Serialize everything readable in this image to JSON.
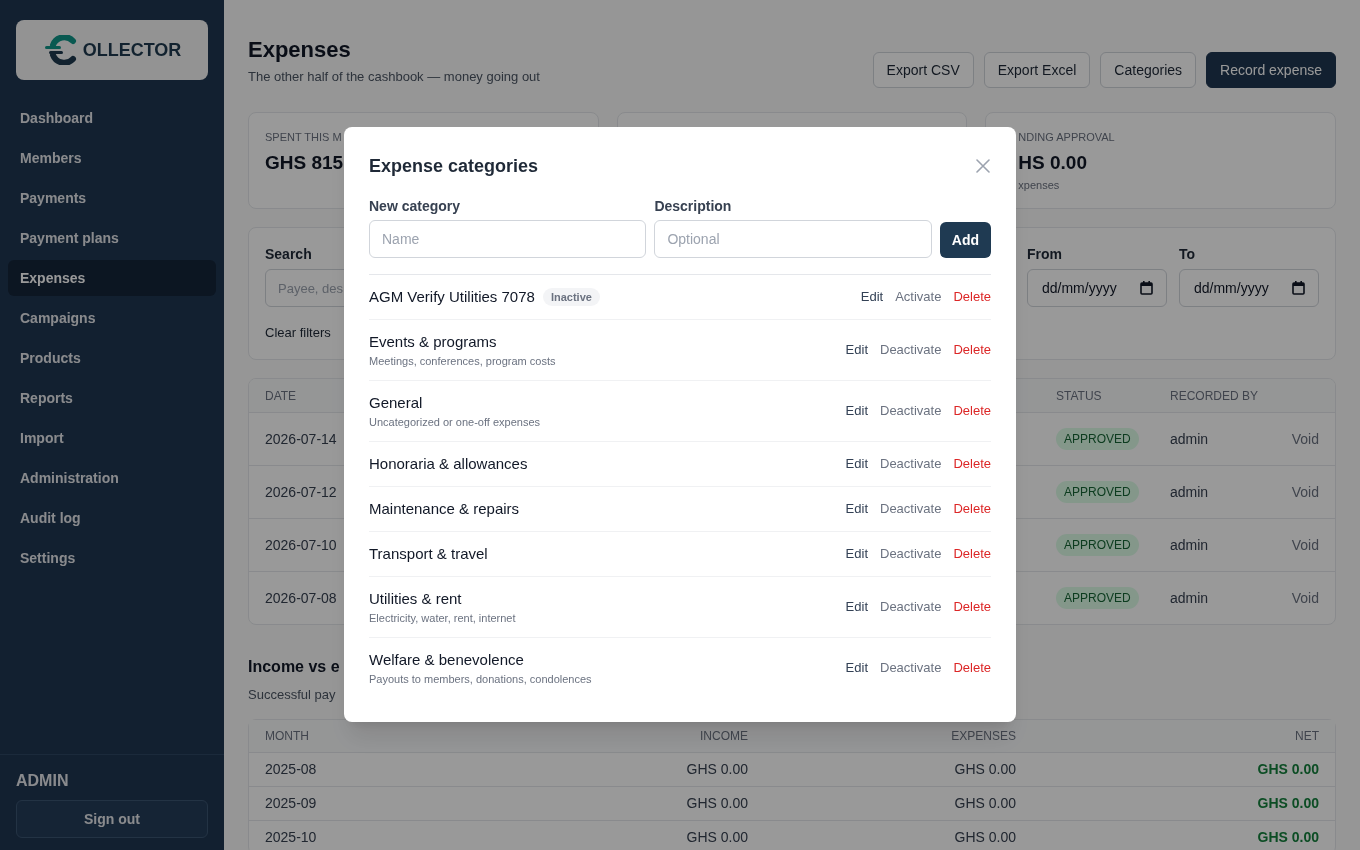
{
  "sidebar": {
    "logo": {
      "text": "OLLECTOR"
    },
    "items": [
      {
        "label": "Dashboard",
        "selected": false
      },
      {
        "label": "Members",
        "selected": false
      },
      {
        "label": "Payments",
        "selected": false
      },
      {
        "label": "Payment plans",
        "selected": false
      },
      {
        "label": "Expenses",
        "selected": true
      },
      {
        "label": "Campaigns",
        "selected": false
      },
      {
        "label": "Products",
        "selected": false
      },
      {
        "label": "Reports",
        "selected": false
      },
      {
        "label": "Import",
        "selected": false
      },
      {
        "label": "Administration",
        "selected": false
      },
      {
        "label": "Audit log",
        "selected": false
      },
      {
        "label": "Settings",
        "selected": false
      }
    ],
    "user": "ADMIN",
    "sign_out": "Sign out"
  },
  "header": {
    "title": "Expenses",
    "subtitle": "The other half of the cashbook — money going out",
    "buttons": [
      {
        "label": "Export CSV",
        "kind": "outline"
      },
      {
        "label": "Export Excel",
        "kind": "outline"
      },
      {
        "label": "Categories",
        "kind": "outline"
      },
      {
        "label": "Record expense",
        "kind": "primary"
      }
    ]
  },
  "stat_cards": [
    {
      "label": "SPENT THIS M",
      "value": "GHS 815"
    },
    {
      "label": "NDING APPROVAL",
      "value": "HS 0.00",
      "note": "xpenses"
    }
  ],
  "filters": {
    "search": {
      "label": "Search",
      "placeholder": "Payee, des"
    },
    "dates": [
      {
        "label": "From",
        "value": "dd/mm/yyyy"
      },
      {
        "label": "To",
        "value": "dd/mm/yyyy"
      }
    ],
    "clear": "Clear filters"
  },
  "expenses_table": {
    "columns": {
      "date": "DATE",
      "status": "STATUS",
      "recorded_by": "RECORDED BY"
    },
    "rows": [
      {
        "date": "2026-07-14",
        "status": "APPROVED",
        "recorded_by": "admin",
        "action": "Void"
      },
      {
        "date": "2026-07-12",
        "status": "APPROVED",
        "recorded_by": "admin",
        "action": "Void"
      },
      {
        "date": "2026-07-10",
        "status": "APPROVED",
        "recorded_by": "admin",
        "action": "Void"
      },
      {
        "date": "2026-07-08",
        "status": "APPROVED",
        "recorded_by": "admin",
        "action": "Void"
      }
    ]
  },
  "income_section": {
    "title": "Income vs e",
    "subtitle": "Successful pay",
    "columns": [
      "MONTH",
      "INCOME",
      "EXPENSES",
      "NET"
    ],
    "rows": [
      {
        "month": "2025-08",
        "income": "GHS 0.00",
        "expenses": "GHS 0.00",
        "net": "GHS 0.00"
      },
      {
        "month": "2025-09",
        "income": "GHS 0.00",
        "expenses": "GHS 0.00",
        "net": "GHS 0.00"
      },
      {
        "month": "2025-10",
        "income": "GHS 0.00",
        "expenses": "GHS 0.00",
        "net": "GHS 0.00"
      }
    ]
  },
  "modal": {
    "title": "Expense categories",
    "fields": [
      {
        "label": "New category",
        "placeholder": "Name"
      },
      {
        "label": "Description",
        "placeholder": "Optional"
      }
    ],
    "add_button": "Add",
    "categories": [
      {
        "name": "AGM Verify Utilities 7078",
        "badge": "Inactive",
        "actions": [
          {
            "label": "Edit",
            "kind": "edit"
          },
          {
            "label": "Activate",
            "kind": "toggle"
          },
          {
            "label": "Delete",
            "kind": "delete"
          }
        ]
      },
      {
        "name": "Events & programs",
        "description": "Meetings, conferences, program costs",
        "actions": [
          {
            "label": "Edit",
            "kind": "edit"
          },
          {
            "label": "Deactivate",
            "kind": "toggle"
          },
          {
            "label": "Delete",
            "kind": "delete"
          }
        ]
      },
      {
        "name": "General",
        "description": "Uncategorized or one-off expenses",
        "actions": [
          {
            "label": "Edit",
            "kind": "edit"
          },
          {
            "label": "Deactivate",
            "kind": "toggle"
          },
          {
            "label": "Delete",
            "kind": "delete"
          }
        ]
      },
      {
        "name": "Honoraria & allowances",
        "actions": [
          {
            "label": "Edit",
            "kind": "edit"
          },
          {
            "label": "Deactivate",
            "kind": "toggle"
          },
          {
            "label": "Delete",
            "kind": "delete"
          }
        ]
      },
      {
        "name": "Maintenance & repairs",
        "actions": [
          {
            "label": "Edit",
            "kind": "edit"
          },
          {
            "label": "Deactivate",
            "kind": "toggle"
          },
          {
            "label": "Delete",
            "kind": "delete"
          }
        ]
      },
      {
        "name": "Transport & travel",
        "actions": [
          {
            "label": "Edit",
            "kind": "edit"
          },
          {
            "label": "Deactivate",
            "kind": "toggle"
          },
          {
            "label": "Delete",
            "kind": "delete"
          }
        ]
      },
      {
        "name": "Utilities & rent",
        "description": "Electricity, water, rent, internet",
        "actions": [
          {
            "label": "Edit",
            "kind": "edit"
          },
          {
            "label": "Deactivate",
            "kind": "toggle"
          },
          {
            "label": "Delete",
            "kind": "delete"
          }
        ]
      },
      {
        "name": "Welfare & benevolence",
        "description": "Payouts to members, donations, condolences",
        "actions": [
          {
            "label": "Edit",
            "kind": "edit"
          },
          {
            "label": "Deactivate",
            "kind": "toggle"
          },
          {
            "label": "Delete",
            "kind": "delete"
          }
        ]
      }
    ]
  }
}
